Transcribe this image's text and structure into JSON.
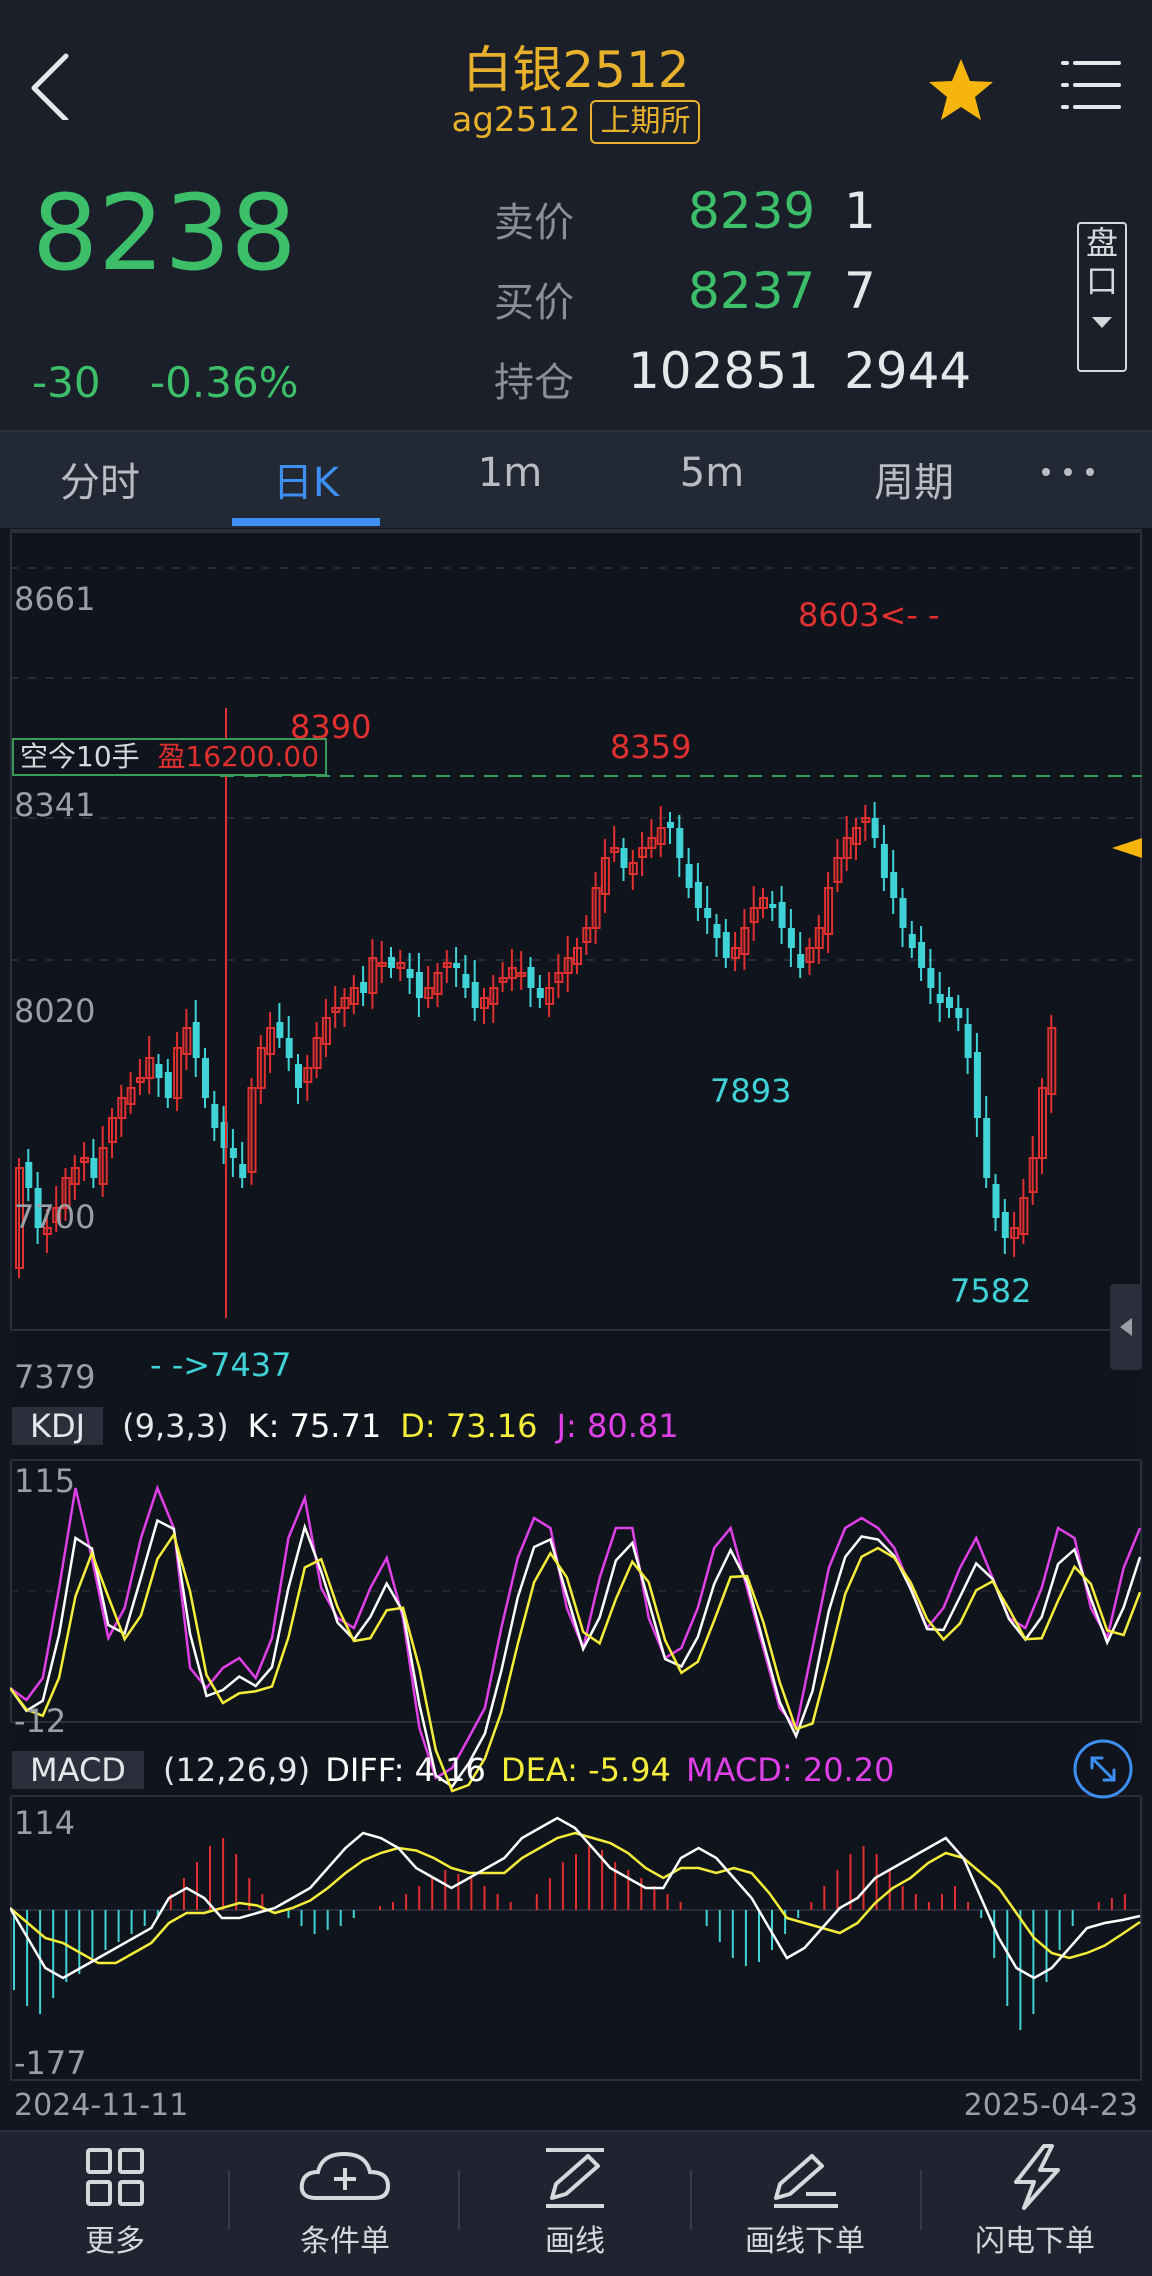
{
  "header": {
    "title": "白银2512",
    "code": "ag2512",
    "exchange": "上期所"
  },
  "quote": {
    "last": "8238",
    "change": "-30",
    "change_pct": "-0.36%",
    "ask_label": "卖价",
    "ask_price": "8239",
    "ask_vol": "1",
    "bid_label": "买价",
    "bid_price": "8237",
    "bid_vol": "7",
    "oi_label": "持仓",
    "oi": "102851",
    "oi_chg": "2944",
    "pankou": [
      "盘",
      "口"
    ]
  },
  "tabs": [
    "分时",
    "日K",
    "1m",
    "5m",
    "周期"
  ],
  "active_tab": "日K",
  "main_chart": {
    "y_ticks": [
      "8661",
      "8341",
      "8020",
      "7700",
      "7379"
    ],
    "position_label": "空今10手",
    "position_profit": "盈16200.00",
    "annotations": [
      "8390",
      "8359",
      "8603<- -",
      "7893",
      "7582",
      "- ->7437"
    ]
  },
  "kdj": {
    "name": "KDJ",
    "params": "(9,3,3)",
    "k": "K: 75.71",
    "d": "D: 73.16",
    "j": "J: 80.81",
    "y_max": "115",
    "y_min": "-12"
  },
  "macd": {
    "name": "MACD",
    "params": "(12,26,9)",
    "diff": "DIFF: 4.16",
    "dea": "DEA: -5.94",
    "macd": "MACD: 20.20",
    "y_max": "114",
    "y_min": "-177"
  },
  "dates": {
    "start": "2024-11-11",
    "end": "2025-04-23"
  },
  "nav": [
    {
      "label": "更多",
      "icon": "grid-icon"
    },
    {
      "label": "条件单",
      "icon": "cloud-plus-icon"
    },
    {
      "label": "画线",
      "icon": "pen-line-icon"
    },
    {
      "label": "画线下单",
      "icon": "pen-order-icon"
    },
    {
      "label": "闪电下单",
      "icon": "lightning-icon"
    }
  ],
  "colors": {
    "up": "#e0302f",
    "down": "#3fd3d8",
    "green": "#3dbf6a",
    "accent": "#3d8ff1",
    "gold": "#e8b12c",
    "kdj_k": "#ffffff",
    "kdj_d": "#f4ee3b",
    "kdj_j": "#e040e8"
  }
}
